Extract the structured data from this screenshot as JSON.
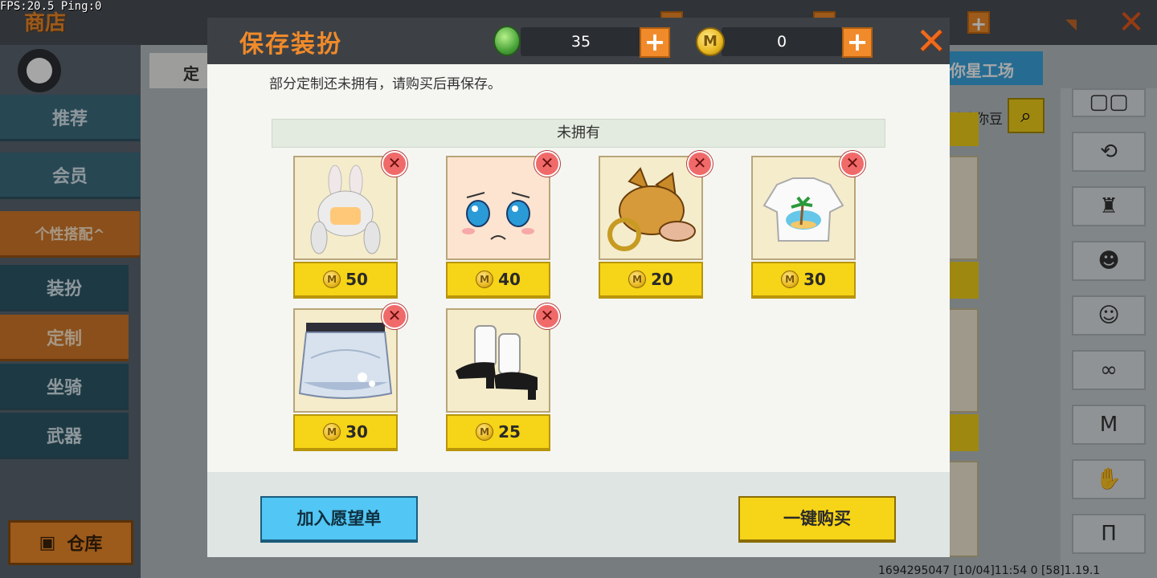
{
  "status": {
    "fps_text": "FPS:20.5  Ping:0"
  },
  "shop": {
    "title": "商店",
    "sidebar": {
      "items": [
        {
          "label": "推荐",
          "icon": "thumbs-up-icon"
        },
        {
          "label": "会员",
          "icon": "vip-icon"
        },
        {
          "label": "个性搭配^",
          "icon": "trophy-icon"
        },
        {
          "label": "装扮",
          "icon": "shirt-icon"
        },
        {
          "label": "定制",
          "icon": "pencil-icon"
        },
        {
          "label": "坐骑",
          "icon": "mount-icon"
        },
        {
          "label": "武器",
          "icon": "gun-icon"
        }
      ],
      "warehouse_label": "仓库"
    },
    "tab_label": "定",
    "workshop_label": "你星工场",
    "mini_bean_label": "看迷你豆",
    "footer_info": "1694295047   [10/04]11:54 0   [58]1.19.1"
  },
  "dialog": {
    "title": "保存装扮",
    "gems": "35",
    "coins": "0",
    "message": "部分定制还未拥有，请购买后再保存。",
    "section_title": "未拥有",
    "items": [
      {
        "name": "bunny-ear-hair",
        "price": "50"
      },
      {
        "name": "crying-face",
        "price": "40"
      },
      {
        "name": "shiba-mask",
        "price": "20"
      },
      {
        "name": "beach-tshirt",
        "price": "30"
      },
      {
        "name": "floral-skirt",
        "price": "30"
      },
      {
        "name": "black-shoes-white-socks",
        "price": "25"
      }
    ],
    "wishlist_button": "加入愿望单",
    "buy_all_button": "一键购买"
  },
  "colors": {
    "accent": "#f08a2a",
    "gold_button": "#f6d417",
    "blue_button": "#52c6f4",
    "header": "#3d4146"
  }
}
